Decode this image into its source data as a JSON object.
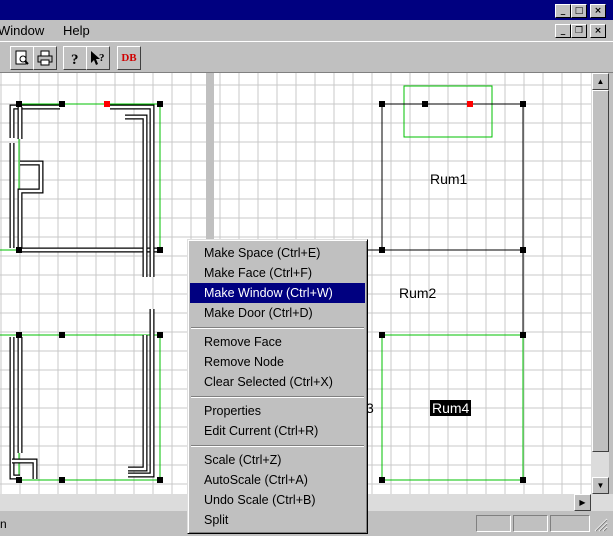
{
  "menubar": {
    "window": "Window",
    "help": "Help"
  },
  "window_buttons": {
    "minimize": "_",
    "maximize": "□",
    "close": "×"
  },
  "doc_buttons": {
    "minimize": "_",
    "restore": "❐",
    "close": "×"
  },
  "toolbar": {
    "print_preview_icon": "print-preview-icon",
    "print_icon": "printer-icon",
    "help_icon": "help-icon",
    "context_help_icon": "context-help-icon",
    "db_label": "DB"
  },
  "rooms": {
    "rum1": "Rum1",
    "rum2": "Rum2",
    "rum3_partial": "3",
    "rum4": "Rum4"
  },
  "context_menu": {
    "items": [
      "Make Space (Ctrl+E)",
      "Make Face (Ctrl+F)",
      "Make Window (Ctrl+W)",
      "Make Door (Ctrl+D)",
      "Remove Face",
      "Remove Node",
      "Clear Selected (Ctrl+X)",
      "Properties",
      "Edit Current (Ctrl+R)",
      "Scale (Ctrl+Z)",
      "AutoScale (Ctrl+A)",
      "Undo Scale (Ctrl+B)",
      "Split"
    ],
    "selected": "Make Window (Ctrl+W)"
  },
  "status": {
    "left_text": "n"
  },
  "colors": {
    "title": "#000080",
    "highlight": "#000080",
    "grid": "#c8c8c8",
    "green": "#00c000",
    "node": "#000000",
    "selected_node": "#ff0000"
  }
}
